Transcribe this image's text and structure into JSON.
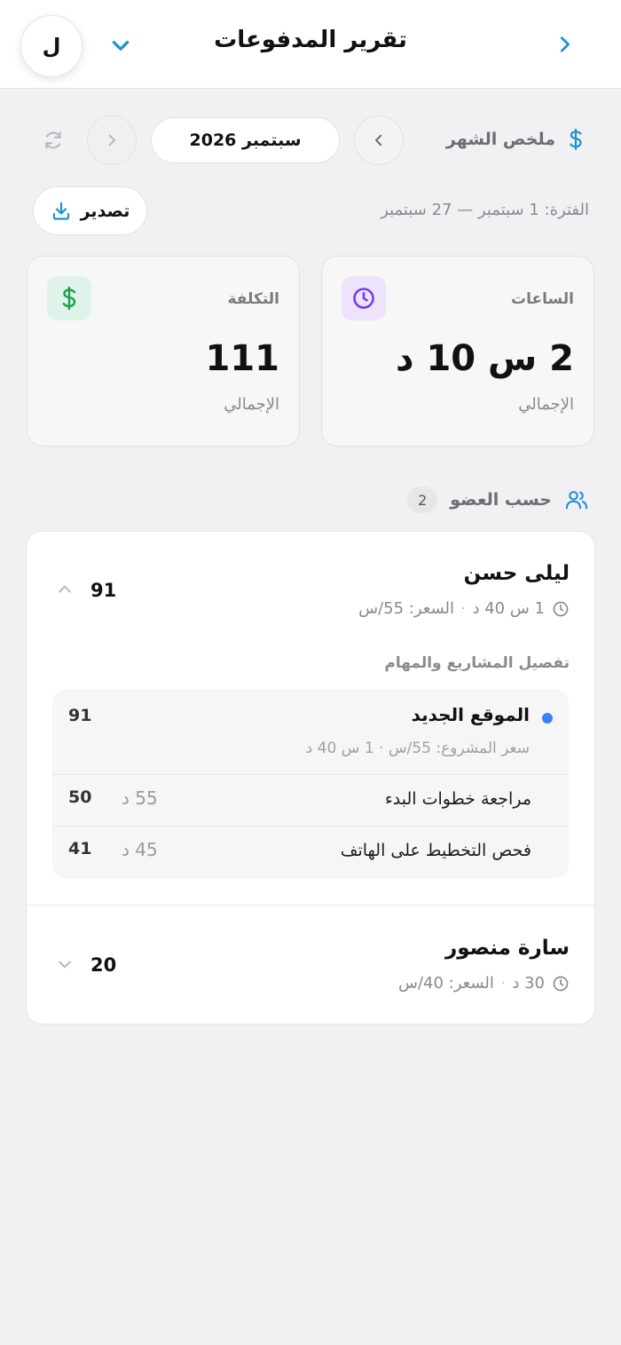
{
  "header": {
    "title": "تقرير المدفوعات",
    "avatar_initial": "ل"
  },
  "month": {
    "summary_label": "ملخص الشهر",
    "current": "سبتمبر 2026",
    "period": "الفترة: 1 سبتمبر — 27 سبتمبر",
    "export_label": "تصدير"
  },
  "stats": {
    "hours": {
      "label": "الساعات",
      "value": "2 س 10 د",
      "sub": "الإجمالي"
    },
    "cost": {
      "label": "التكلفة",
      "value": "111",
      "sub": "الإجمالي"
    }
  },
  "members_section": {
    "title": "حسب العضو",
    "count": "2",
    "breakdown_title": "تفصيل المشاريع والمهام",
    "members": [
      {
        "name": "ليلى حسن",
        "duration": "1 س 40 د",
        "rate": "السعر: 55/س",
        "total": "91",
        "expanded": true,
        "projects": [
          {
            "name": "الموقع الجديد",
            "meta": "سعر المشروع: 55/س · 1 س 40 د",
            "total": "91",
            "color": "#3b82f6",
            "tasks": [
              {
                "name": "مراجعة خطوات البدء",
                "duration": "55 د",
                "cost": "50"
              },
              {
                "name": "فحص التخطيط على الهاتف",
                "duration": "45 د",
                "cost": "41"
              }
            ]
          }
        ]
      },
      {
        "name": "سارة منصور",
        "duration": "30 د",
        "rate": "السعر: 40/س",
        "total": "20",
        "expanded": false
      }
    ]
  },
  "colors": {
    "accent": "#1f8fd6",
    "purple": "#7c3aed",
    "green": "#16a34a",
    "project_dot": "#3b82f6"
  }
}
